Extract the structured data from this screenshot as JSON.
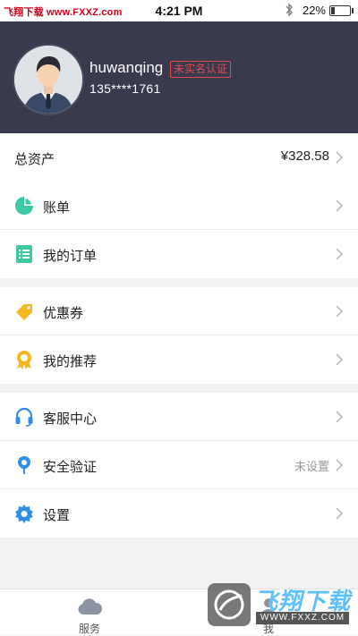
{
  "status_bar": {
    "watermark": "飞翔下载 www.FXXZ.com",
    "time": "4:21 PM",
    "battery_percent": "22%",
    "battery_level": 0.22
  },
  "profile": {
    "username": "huwanqing",
    "verify_badge": "未实名认证",
    "phone": "135****1761"
  },
  "total": {
    "label": "总资产",
    "value": "¥328.58"
  },
  "groups": [
    [
      {
        "label": "账单",
        "icon": "pie-chart-icon",
        "color": "#3cc9a3"
      },
      {
        "label": "我的订单",
        "icon": "order-list-icon",
        "color": "#3cc9a3"
      }
    ],
    [
      {
        "label": "优惠券",
        "icon": "coupon-tag-icon",
        "color": "#f5b71f"
      },
      {
        "label": "我的推荐",
        "icon": "badge-ribbon-icon",
        "color": "#f5b71f"
      }
    ],
    [
      {
        "label": "客服中心",
        "icon": "headset-icon",
        "color": "#2f8fe8"
      },
      {
        "label": "安全验证",
        "icon": "location-pin-icon",
        "color": "#2f8fe8",
        "value": "未设置"
      },
      {
        "label": "设置",
        "icon": "gear-icon",
        "color": "#2f8fe8"
      }
    ]
  ],
  "tabbar": {
    "tabs": [
      {
        "label": "服务",
        "icon": "cloud-icon"
      },
      {
        "label": "我",
        "icon": "person-icon"
      }
    ]
  },
  "site_watermark": {
    "brand": "飞翔下载",
    "domain": "WWW.FXXZ.COM"
  }
}
